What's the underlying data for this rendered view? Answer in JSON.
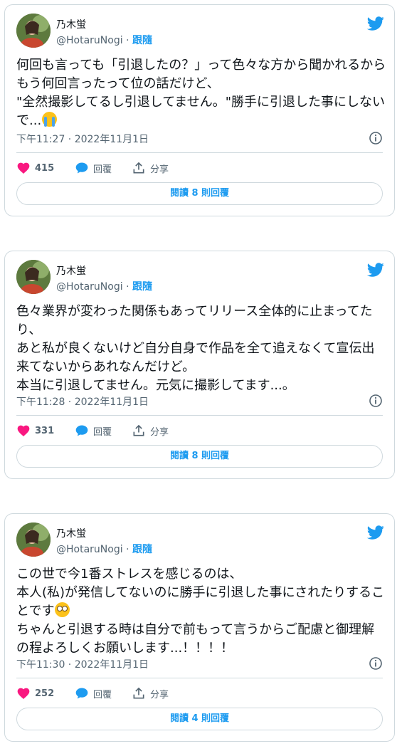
{
  "colors": {
    "accent": "#1d9bf0",
    "like": "#f91880",
    "secondary": "#536471",
    "border": "#cfd9de"
  },
  "tweets": [
    {
      "name": "乃木蛍",
      "handle": "@HotaruNogi",
      "separator": "·",
      "follow_label": "跟隨",
      "text": "何回も言っても「引退したの？」って色々な方から聞かれるからもう何回言ったって位の話だけど、\n\"全然撮影してるし引退してません。\"勝手に引退した事にしないで...",
      "emoji_icon": "loudly-crying-face-icon",
      "timestamp": "下午11:27 · 2022年11月1日",
      "likes": "415",
      "reply_label": "回覆",
      "share_label": "分享",
      "read_replies_label": "閱讀 8 則回覆"
    },
    {
      "name": "乃木蛍",
      "handle": "@HotaruNogi",
      "separator": "·",
      "follow_label": "跟隨",
      "text": "色々業界が変わった関係もあってリリース全体的に止まってたり、\nあと私が良くないけど自分自身で作品を全て追えなくて宣伝出来てないからあれなんだけど。\n本当に引退してません。元気に撮影してます...。",
      "timestamp": "下午11:28 · 2022年11月1日",
      "likes": "331",
      "reply_label": "回覆",
      "share_label": "分享",
      "read_replies_label": "閱讀 8 則回覆"
    },
    {
      "name": "乃木蛍",
      "handle": "@HotaruNogi",
      "separator": "·",
      "follow_label": "跟隨",
      "text_part1": "この世で今1番ストレスを感じるのは、\n本人(私)が発信してないのに勝手に引退した事にされたりすることです",
      "emoji_icon": "face-with-rolling-eyes-icon",
      "text_part2": "\nちゃんと引退する時は自分で前もって言うからご配慮と御理解の程よろしくお願いします...！！！！",
      "timestamp": "下午11:30 · 2022年11月1日",
      "likes": "252",
      "reply_label": "回覆",
      "share_label": "分享",
      "read_replies_label": "閱讀 4 則回覆"
    }
  ]
}
